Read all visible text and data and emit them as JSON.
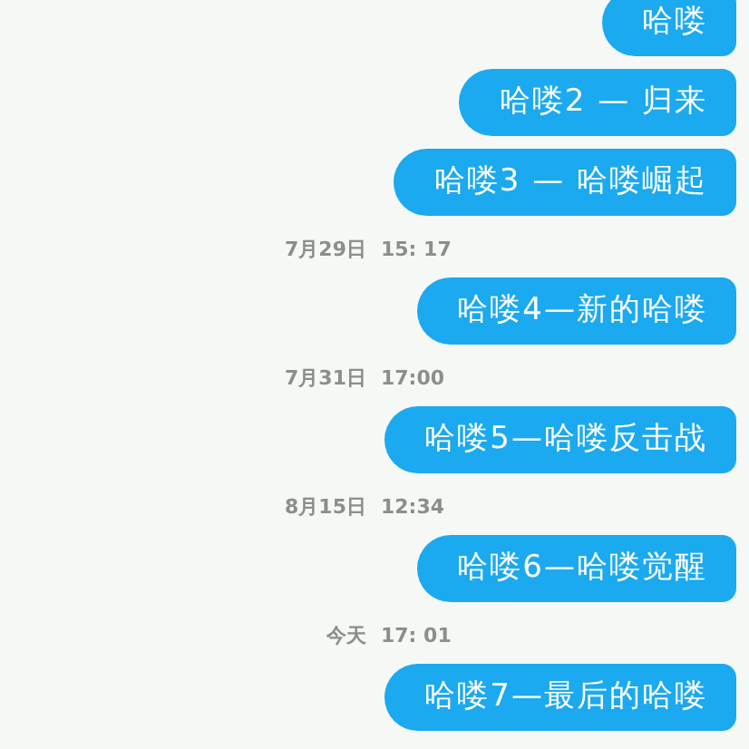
{
  "messages": [
    {
      "kind": "bubble",
      "text": "哈喽"
    },
    {
      "kind": "bubble",
      "text": "哈喽2 — 归来"
    },
    {
      "kind": "bubble",
      "text": "哈喽3 — 哈喽崛起"
    },
    {
      "kind": "timestamp",
      "date": "7月29日",
      "time": "15: 17"
    },
    {
      "kind": "bubble",
      "text": "哈喽4—新的哈喽"
    },
    {
      "kind": "timestamp",
      "date": "7月31日",
      "time": "17:00"
    },
    {
      "kind": "bubble",
      "text": "哈喽5—哈喽反击战"
    },
    {
      "kind": "timestamp",
      "date": "8月15日",
      "time": "12:34"
    },
    {
      "kind": "bubble",
      "text": "哈喽6—哈喽觉醒"
    },
    {
      "kind": "timestamp",
      "date": "今天",
      "time": "17: 01"
    },
    {
      "kind": "bubble",
      "text": "哈喽7—最后的哈喽"
    }
  ]
}
